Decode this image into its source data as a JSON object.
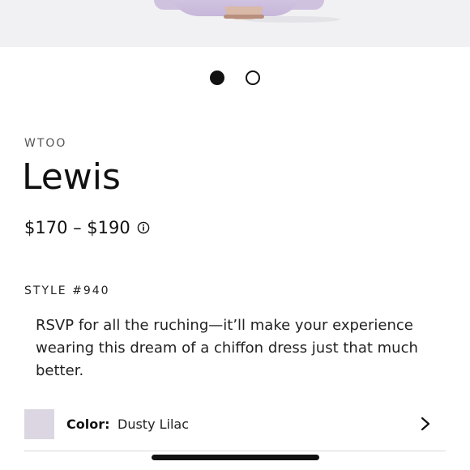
{
  "gallery": {
    "total_images": 2,
    "active_index": 0
  },
  "product": {
    "brand": "WTOO",
    "name": "Lewis",
    "price_range": "$170 – $190",
    "style_number": "STYLE #940",
    "description": "RSVP for all the ruching—it’ll make your experience wearing this dream of a chiffon dress just that much better."
  },
  "color_selector": {
    "label": "Color:",
    "value": "Dusty Lilac",
    "swatch_color": "#dcd6e2"
  },
  "icons": {
    "price_info": "info-icon",
    "color_chevron": "chevron-right-icon"
  }
}
